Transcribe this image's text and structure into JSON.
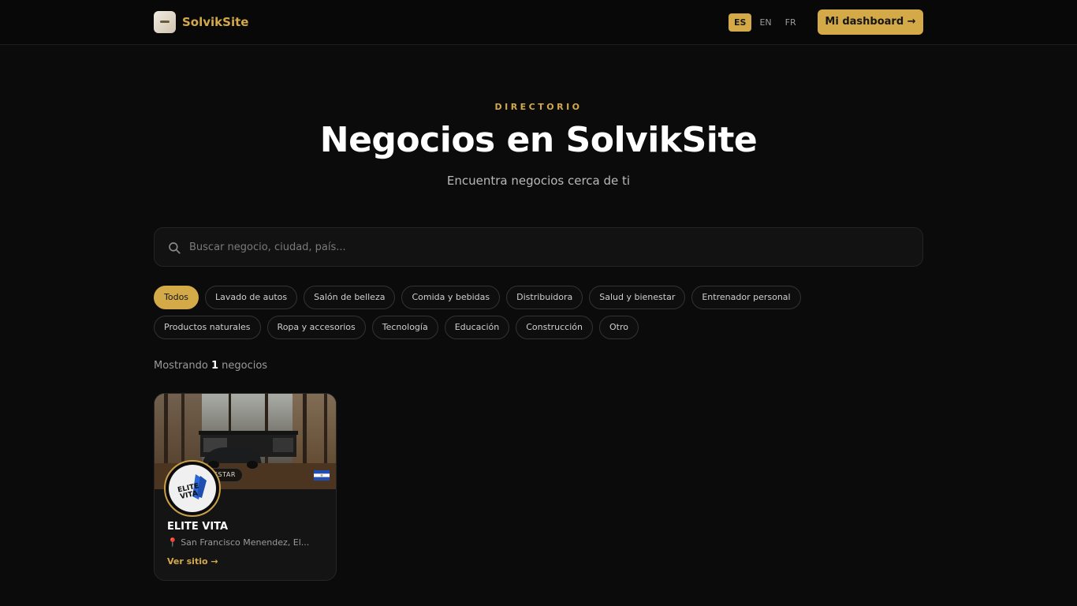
{
  "header": {
    "brand": "SolvikSite",
    "languages": [
      {
        "code": "ES",
        "active": true
      },
      {
        "code": "EN",
        "active": false
      },
      {
        "code": "FR",
        "active": false
      }
    ],
    "dashboard_label": "Mi dashboard →"
  },
  "hero": {
    "eyebrow": "DIRECTORIO",
    "title": "Negocios en SolvikSite",
    "subtitle": "Encuentra negocios cerca de ti"
  },
  "search": {
    "placeholder": "Buscar negocio, ciudad, país...",
    "value": "",
    "icon": "search-icon"
  },
  "categories": [
    [
      "Todos",
      "Lavado de autos",
      "Salón de belleza",
      "Comida y bebidas",
      "Distribuidora",
      "Salud y bienestar",
      "Entrenador personal"
    ],
    [
      "Productos naturales",
      "Ropa y accesorios",
      "Tecnología",
      "Educación",
      "Construcción",
      "Otro"
    ]
  ],
  "active_category": "Todos",
  "results": {
    "prefix": "Mostrando",
    "count": "1",
    "suffix": "negocios"
  },
  "businesses": [
    {
      "name": "ELITE VITA",
      "tag": "ESTAR",
      "location": "📍 San Francisco Menendez, El...",
      "link_label": "Ver sitio →",
      "flag": "El Salvador flag",
      "logo_text": "ELITE VITA"
    }
  ],
  "colors": {
    "accent": "#d4aa49",
    "background": "#0b0b0b",
    "card": "#141414"
  }
}
